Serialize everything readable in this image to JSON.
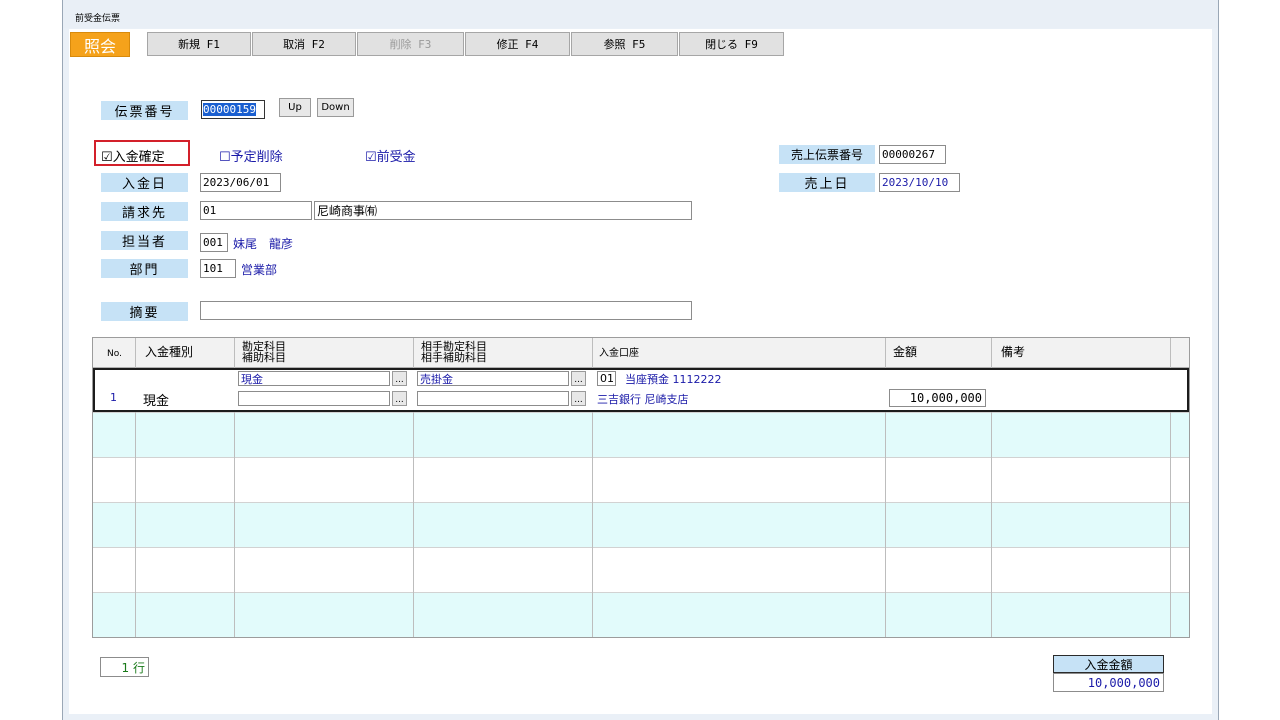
{
  "window": {
    "title": "前受金伝票"
  },
  "mode": "照会",
  "toolbar": {
    "new": "新規 F1",
    "cancel": "取消 F2",
    "delete": "削除 F3",
    "edit": "修正 F4",
    "reference": "参照 F5",
    "close": "閉じる F9"
  },
  "form": {
    "slip_no_label": "伝票番号",
    "slip_no": "00000159",
    "up": "Up",
    "down": "Down",
    "chk_confirmed": "☑入金確定",
    "chk_scheduled_delete": "☐予定削除",
    "chk_advance": "☑前受金",
    "sales_slip_label": "売上伝票番号",
    "sales_slip_no": "00000267",
    "deposit_date_label": "入金日",
    "deposit_date": "2023/06/01",
    "sales_date_label": "売上日",
    "sales_date": "2023/10/10",
    "billing_label": "請求先",
    "billing_code": "01",
    "billing_name": "尼崎商事㈲",
    "staff_label": "担当者",
    "staff_code": "001",
    "staff_name": "妹尾　龍彦",
    "dept_label": "部門",
    "dept_code": "101",
    "dept_name": "営業部",
    "memo_label": "摘要",
    "memo": ""
  },
  "grid": {
    "headers": {
      "no": "No.",
      "type": "入金種別",
      "account1": "勘定科目",
      "account2": "補助科目",
      "counter1": "相手勘定科目",
      "counter2": "相手補助科目",
      "bank": "入金口座",
      "amount": "金額",
      "note": "備考"
    },
    "rows": [
      {
        "no": "1",
        "type": "現金",
        "account": "現金",
        "sub_account": "",
        "counter_account": "売掛金",
        "counter_sub": "",
        "bank_code": "01",
        "bank_line1": "当座預金 1112222",
        "bank_line2": "三吉銀行 尼崎支店",
        "amount": "10,000,000",
        "note": ""
      }
    ],
    "dots": "..."
  },
  "footer": {
    "row_count": "1 行",
    "total_label": "入金金額",
    "total_value": "10,000,000"
  },
  "colors": {
    "label_bg": "#c6e2f6",
    "mode_badge": "#f5a21b",
    "value_blue": "#1a1aa8",
    "row_band": "#e2fbfb",
    "highlight_border": "#d3202a"
  }
}
